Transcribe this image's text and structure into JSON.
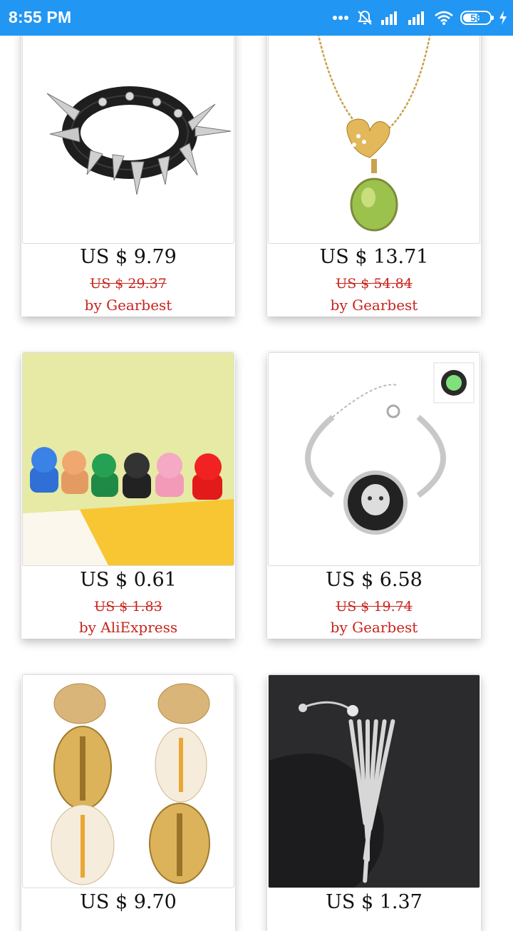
{
  "status_bar": {
    "time": "8:55 PM",
    "battery_percent": "58",
    "battery_level": 0.58
  },
  "products": [
    {
      "image": "spiked-leather-bracelet",
      "price": "US $ 9.79",
      "original_price": "US $ 29.37",
      "seller": "by Gearbest"
    },
    {
      "image": "gold-heart-crystal-necklace",
      "price": "US $ 13.71",
      "original_price": "US $ 54.84",
      "seller": "by Gearbest"
    },
    {
      "image": "colorful-bulldog-keychains",
      "price": "US $ 0.61",
      "original_price": "US $ 1.83",
      "seller": "by AliExpress"
    },
    {
      "image": "glow-cabochon-bangle",
      "price": "US $ 6.58",
      "original_price": "US $ 19.74",
      "seller": "by Gearbest"
    },
    {
      "image": "cowrie-shell-earrings",
      "price": "US $ 9.70",
      "original_price": "",
      "seller": ""
    },
    {
      "image": "rhinestone-tassel-belly-ring",
      "price": "US $ 1.37",
      "original_price": "",
      "seller": ""
    }
  ],
  "colors": {
    "status_bar_bg": "#2196f3",
    "sale_red": "#c8231b"
  }
}
